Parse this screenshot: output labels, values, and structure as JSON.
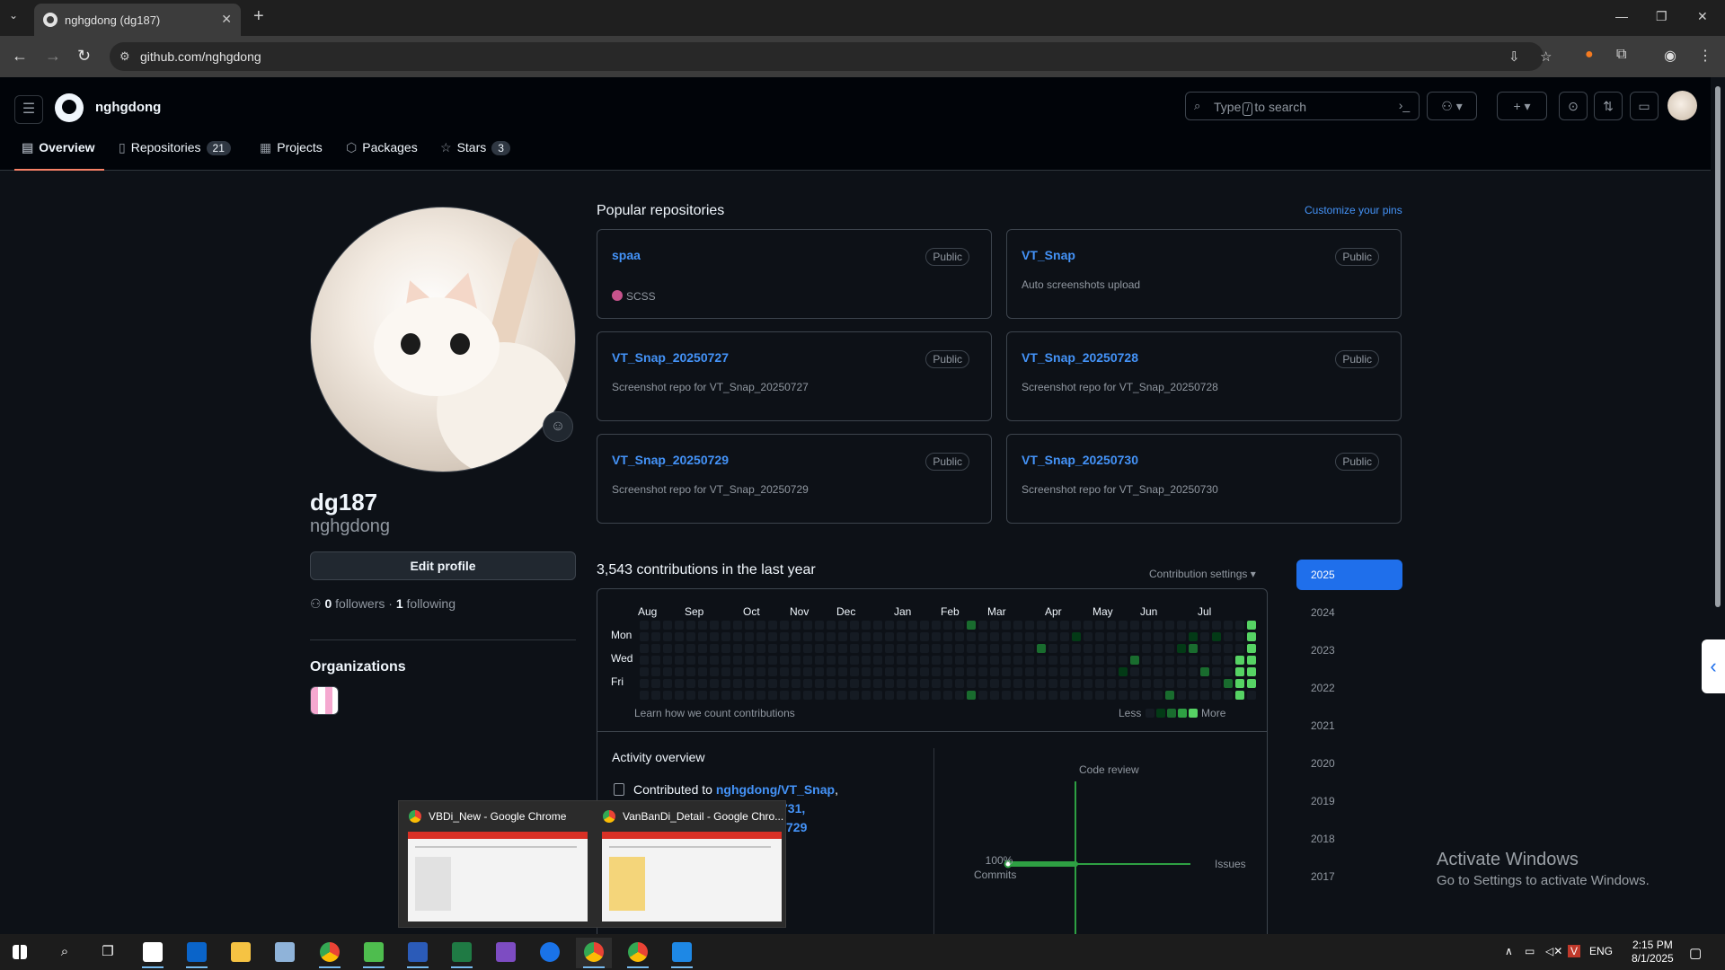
{
  "browser": {
    "tab_title": "nghgdong (dg187)",
    "url": "github.com/nghgdong"
  },
  "header": {
    "username": "nghgdong",
    "search_prefix": "Type",
    "search_key": "/",
    "search_suffix": "to search"
  },
  "profile_tabs": [
    {
      "label": "Overview",
      "icon": "book-icon",
      "count": ""
    },
    {
      "label": "Repositories",
      "icon": "repo-icon",
      "count": "21"
    },
    {
      "label": "Projects",
      "icon": "table-icon",
      "count": ""
    },
    {
      "label": "Packages",
      "icon": "package-icon",
      "count": ""
    },
    {
      "label": "Stars",
      "icon": "star-icon",
      "count": "3"
    }
  ],
  "profile": {
    "name": "dg187",
    "login": "nghgdong",
    "edit_label": "Edit profile",
    "followers": "0",
    "followers_label": "followers",
    "following": "1",
    "following_label": "following",
    "orgs_heading": "Organizations"
  },
  "pinned": {
    "heading": "Popular repositories",
    "customize": "Customize your pins",
    "repos": [
      {
        "name": "spaa",
        "desc": "",
        "lang": "SCSS",
        "visibility": "Public"
      },
      {
        "name": "VT_Snap",
        "desc": "Auto screenshots upload",
        "lang": "",
        "visibility": "Public"
      },
      {
        "name": "VT_Snap_20250727",
        "desc": "Screenshot repo for VT_Snap_20250727",
        "lang": "",
        "visibility": "Public"
      },
      {
        "name": "VT_Snap_20250728",
        "desc": "Screenshot repo for VT_Snap_20250728",
        "lang": "",
        "visibility": "Public"
      },
      {
        "name": "VT_Snap_20250729",
        "desc": "Screenshot repo for VT_Snap_20250729",
        "lang": "",
        "visibility": "Public"
      },
      {
        "name": "VT_Snap_20250730",
        "desc": "Screenshot repo for VT_Snap_20250730",
        "lang": "",
        "visibility": "Public"
      }
    ]
  },
  "contributions": {
    "heading": "3,543 contributions in the last year",
    "settings": "Contribution settings",
    "months": [
      "Aug",
      "Sep",
      "Oct",
      "Nov",
      "Dec",
      "Jan",
      "Feb",
      "Mar",
      "Apr",
      "May",
      "Jun",
      "Jul"
    ],
    "days": [
      "Mon",
      "Wed",
      "Fri"
    ],
    "learn": "Learn how we count contributions",
    "less": "Less",
    "more": "More"
  },
  "activity": {
    "heading": "Activity overview",
    "contributed_prefix": "Contributed to",
    "repo_link": "nghgdong/VT_Snap",
    "frag1": "731,",
    "frag2": "729",
    "code_review": "Code review",
    "issues": "Issues",
    "commits_pct": "100%",
    "commits_label": "Commits"
  },
  "years": [
    "2025",
    "2024",
    "2023",
    "2022",
    "2021",
    "2020",
    "2019",
    "2018",
    "2017"
  ],
  "selected_year": "2025",
  "watermark": {
    "line1": "Activate Windows",
    "line2": "Go to Settings to activate Windows."
  },
  "thumbnails": [
    {
      "title": "VBDi_New - Google Chrome"
    },
    {
      "title": "VanBanDi_Detail - Google Chro..."
    }
  ],
  "taskbar": {
    "lang": "ENG",
    "time": "2:15 PM",
    "date": "8/1/2025"
  },
  "colors": {
    "accent": "#4493f8",
    "selected_year": "#1f6feb",
    "tab_underline": "#f78166",
    "contrib_levels": [
      "#151b23",
      "#033a16",
      "#196c2e",
      "#2ea043",
      "#56d364"
    ]
  }
}
